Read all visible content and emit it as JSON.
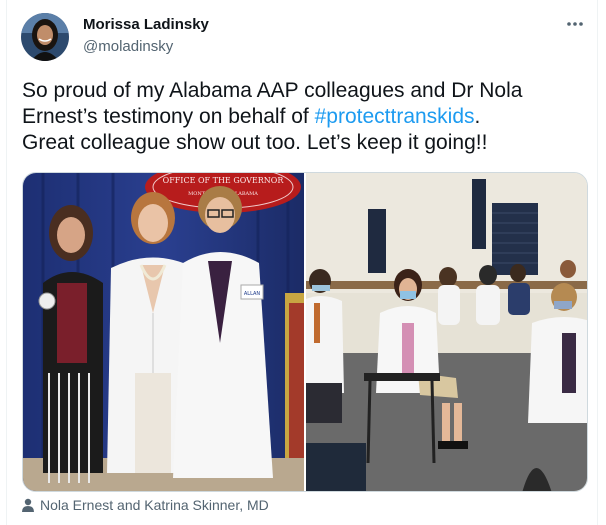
{
  "author": {
    "name": "Morissa Ladinsky",
    "handle": "@moladinsky",
    "avatar_icon": "avatar-photo"
  },
  "menu": {
    "icon": "more-dots-icon"
  },
  "tweet": {
    "line1": "So proud of my Alabama AAP colleagues and Dr Nola",
    "line2_prefix": "Ernest’s testimony on behalf of ",
    "hashtag": "#protecttranskids",
    "line2_suffix": ".",
    "line3": "Great colleague show out too. Let’s keep it going!!"
  },
  "media": {
    "left_photo_sign_top": "OFFICE OF THE GOVERNOR",
    "left_photo_sign_bottom": "MONTGOMERY, ALABAMA",
    "badge_text": "ALLAN"
  },
  "tagged": {
    "icon": "person-icon",
    "text": "Nola Ernest and Katrina Skinner, MD"
  },
  "colors": {
    "link": "#1d9bf0",
    "secondary_text": "#536471",
    "primary_text": "#0f1419"
  }
}
